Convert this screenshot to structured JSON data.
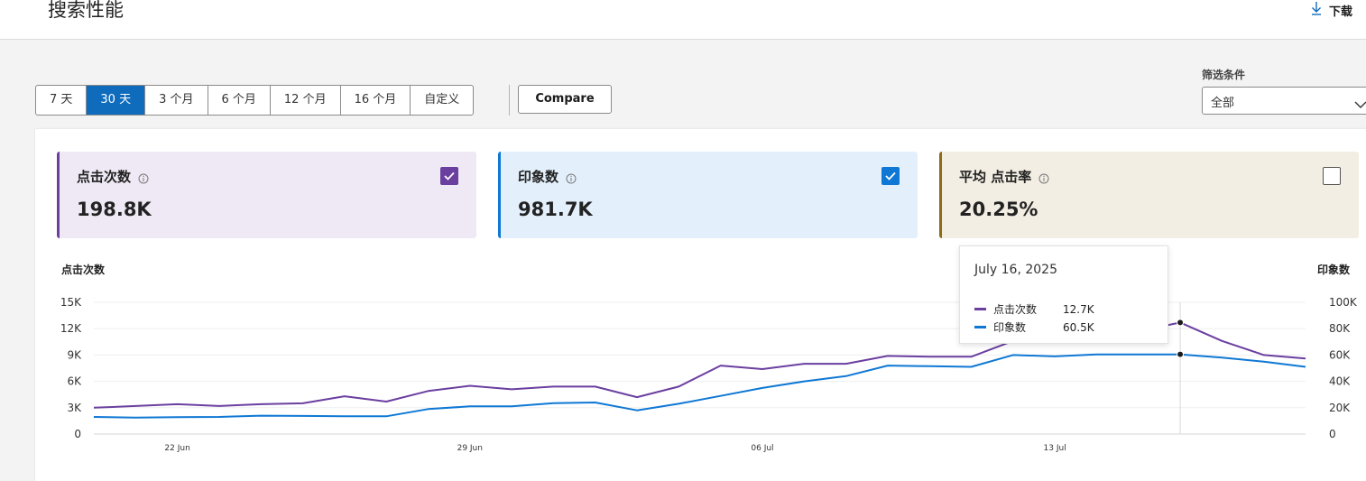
{
  "header": {
    "title": "搜索性能",
    "download_label": "下载"
  },
  "date_ranges": {
    "options": [
      "7 天",
      "30 天",
      "3 个月",
      "6 个月",
      "12 个月",
      "16 个月",
      "自定义"
    ],
    "selected": "30 天"
  },
  "compare_label": "Compare",
  "filter": {
    "label": "筛选条件",
    "value": "全部"
  },
  "metrics": [
    {
      "title": "点击次数",
      "value": "198.8K",
      "checked": true,
      "color": "#6b3fa0",
      "bg": "#efe9f5"
    },
    {
      "title": "印象数",
      "value": "981.7K",
      "checked": true,
      "color": "#0f78d4",
      "bg": "#e3f0fb"
    },
    {
      "title": "平均 点击率",
      "value": "20.25%",
      "checked": false,
      "color": "#8a6d14",
      "bg": "#f2eee3"
    }
  ],
  "tooltip": {
    "date": "July 16, 2025",
    "rows": [
      {
        "name": "点击次数",
        "value": "12.7K",
        "color": "#6b3fa0"
      },
      {
        "name": "印象数",
        "value": "60.5K",
        "color": "#0f78d4"
      }
    ]
  },
  "chart_data": {
    "type": "line",
    "left_axis_label": "点击次数",
    "right_axis_label": "印象数",
    "left_ticks": [
      "0",
      "3K",
      "6K",
      "9K",
      "12K",
      "15K"
    ],
    "right_ticks": [
      "0",
      "20K",
      "40K",
      "60K",
      "80K",
      "100K"
    ],
    "ylim_left": [
      0,
      15000
    ],
    "ylim_right": [
      0,
      100000
    ],
    "x_tick_labels": [
      "22 Jun",
      "29 Jun",
      "06 Jul",
      "13 Jul"
    ],
    "x": [
      "2025-06-20",
      "2025-06-21",
      "2025-06-22",
      "2025-06-23",
      "2025-06-24",
      "2025-06-25",
      "2025-06-26",
      "2025-06-27",
      "2025-06-28",
      "2025-06-29",
      "2025-06-30",
      "2025-07-01",
      "2025-07-02",
      "2025-07-03",
      "2025-07-04",
      "2025-07-05",
      "2025-07-06",
      "2025-07-07",
      "2025-07-08",
      "2025-07-09",
      "2025-07-10",
      "2025-07-11",
      "2025-07-12",
      "2025-07-13",
      "2025-07-14",
      "2025-07-15",
      "2025-07-16",
      "2025-07-17",
      "2025-07-18",
      "2025-07-19"
    ],
    "series": [
      {
        "name": "点击次数",
        "axis": "left",
        "color": "#6b3fa0",
        "values": [
          3000,
          3200,
          3400,
          3200,
          3400,
          3500,
          4300,
          3700,
          4900,
          5500,
          5100,
          5400,
          5400,
          4200,
          5400,
          7800,
          7400,
          8000,
          8000,
          8900,
          8800,
          8800,
          10600,
          10600,
          11200,
          11700,
          12700,
          10600,
          9000,
          8600
        ]
      },
      {
        "name": "印象数",
        "axis": "right",
        "color": "#0f78d4",
        "values": [
          13000,
          12500,
          12800,
          13000,
          14000,
          13800,
          13500,
          13500,
          19000,
          21000,
          21000,
          23500,
          24000,
          18000,
          23000,
          29000,
          35000,
          40000,
          44000,
          52000,
          51500,
          51000,
          60000,
          59000,
          60500,
          60500,
          60500,
          58000,
          55000,
          51000
        ]
      }
    ],
    "grid": true,
    "highlight_date": "2025-07-16"
  }
}
